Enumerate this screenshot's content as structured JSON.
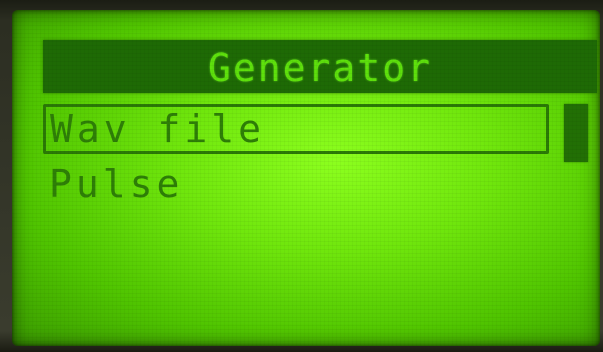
{
  "screen": {
    "title": "Generator"
  },
  "menu": {
    "items": [
      {
        "label": "Wav file",
        "selected": true
      },
      {
        "label": "Pulse",
        "selected": false
      }
    ]
  },
  "colors": {
    "lcd_background": "#6fe60c",
    "pixel_dark": "#1e6a05",
    "pixel_text": "#2e7f07"
  }
}
